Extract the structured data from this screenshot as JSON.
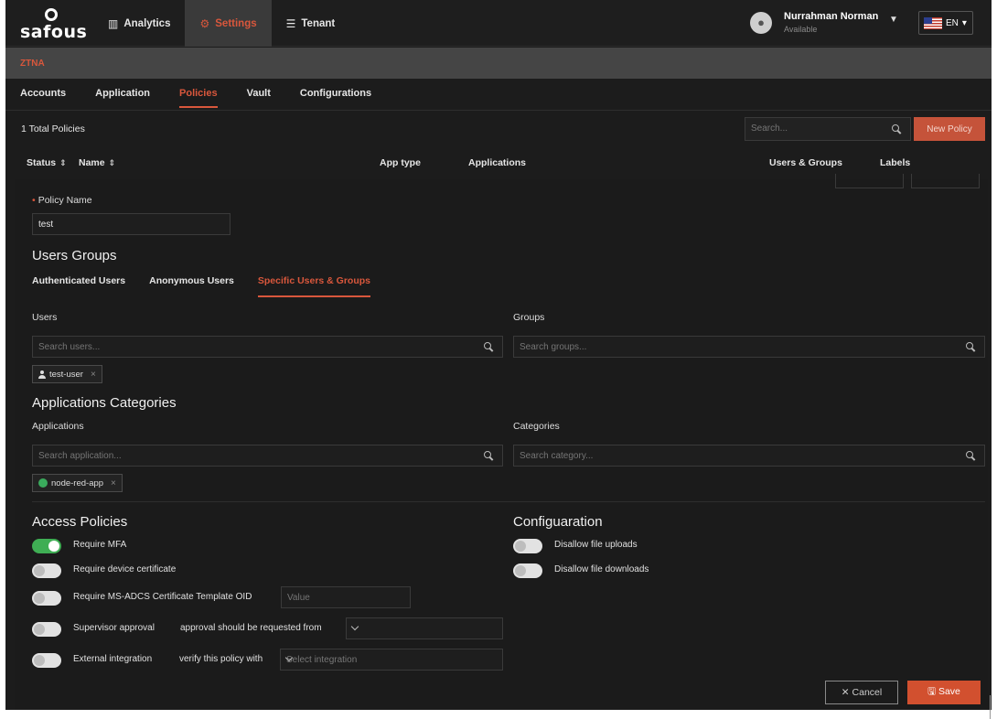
{
  "brand": {
    "logo_text": "safous"
  },
  "nav": [
    {
      "label": "Analytics",
      "icon": "bar-chart-icon"
    },
    {
      "label": "Settings",
      "icon": "gear-icon"
    },
    {
      "label": "Tenant",
      "icon": "list-icon"
    }
  ],
  "user": {
    "name": "Nurrahman Norman",
    "status": "Available"
  },
  "language": {
    "code": "EN"
  },
  "section": {
    "title": "ZTNA"
  },
  "subtabs": [
    "Accounts",
    "Application",
    "Policies",
    "Vault",
    "Configurations"
  ],
  "policies": {
    "total": "1 Total Policies",
    "search_placeholder": "Search...",
    "new_button": "New Policy",
    "columns": [
      "Status",
      "Name",
      "App type",
      "Applications",
      "Users & Groups",
      "Labels"
    ]
  },
  "form": {
    "policy_name_label": "Policy Name",
    "policy_name_value": "test",
    "users_groups_heading": "Users Groups",
    "user_tabs": [
      "Authenticated Users",
      "Anonymous Users",
      "Specific Users & Groups"
    ],
    "users_label": "Users",
    "users_placeholder": "Search users...",
    "groups_label": "Groups",
    "groups_placeholder": "Search groups...",
    "user_chip": "test-user",
    "apps_heading": "Applications Categories",
    "applications_label": "Applications",
    "applications_placeholder": "Search application...",
    "categories_label": "Categories",
    "categories_placeholder": "Search category...",
    "app_chip": "node-red-app",
    "access_heading": "Access Policies",
    "access": [
      {
        "label": "Require MFA",
        "on": true
      },
      {
        "label": "Require device certificate",
        "on": false
      },
      {
        "label": "Require MS-ADCS Certificate Template OID",
        "on": false
      },
      {
        "label": "Supervisor approval",
        "on": false
      },
      {
        "label": "External integration",
        "on": false
      }
    ],
    "oid_placeholder": "Value",
    "approval_from_label": "approval should be requested from",
    "verify_label": "verify this policy with",
    "integration_placeholder": "Select integration",
    "config_heading": "Configuaration",
    "config": [
      {
        "label": "Disallow file uploads",
        "on": false
      },
      {
        "label": "Disallow file downloads",
        "on": false
      }
    ],
    "cancel_button": "Cancel",
    "save_button": "Save"
  },
  "colors": {
    "accent": "#d9573c",
    "toggle_on": "#3fae54",
    "background": "#1c1c1c"
  }
}
